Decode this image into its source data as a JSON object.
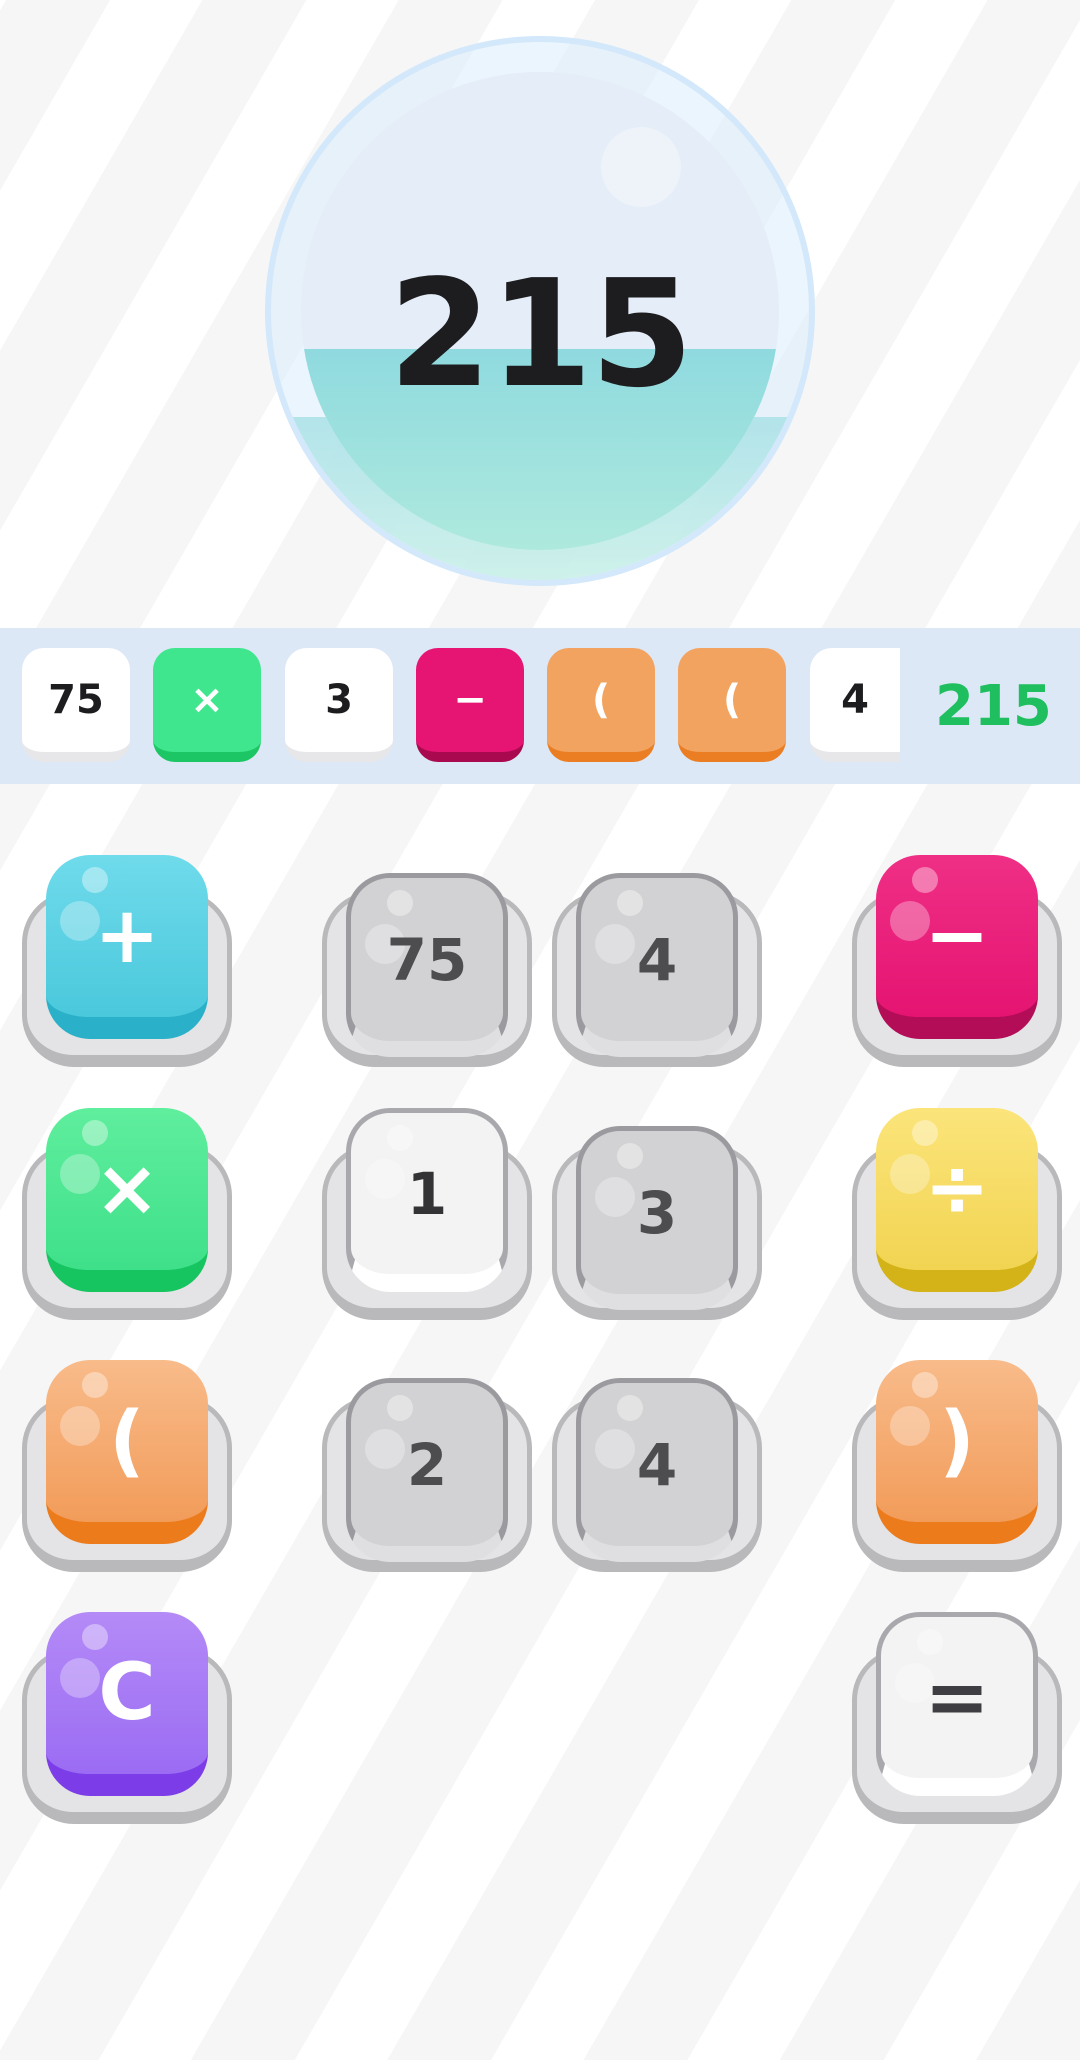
{
  "target": {
    "value": "215",
    "fill_level_percent": 42
  },
  "expression": {
    "tokens": [
      {
        "text": "75",
        "kind": "number"
      },
      {
        "text": "×",
        "kind": "multiply"
      },
      {
        "text": "3",
        "kind": "number"
      },
      {
        "text": "−",
        "kind": "subtract"
      },
      {
        "text": "(",
        "kind": "paren"
      },
      {
        "text": "(",
        "kind": "paren"
      },
      {
        "text": "4",
        "kind": "number"
      }
    ],
    "result": "215",
    "result_color": "#1fbf5f"
  },
  "keypad": {
    "plus": "+",
    "minus": "−",
    "multiply": "×",
    "divide": "÷",
    "open_paren": "(",
    "close_paren": ")",
    "clear": "C",
    "equals": "=",
    "numbers": [
      {
        "value": "75",
        "state": "used"
      },
      {
        "value": "4",
        "state": "used"
      },
      {
        "value": "1",
        "state": "available"
      },
      {
        "value": "3",
        "state": "used"
      },
      {
        "value": "2",
        "state": "used"
      },
      {
        "value": "4",
        "state": "used"
      }
    ]
  },
  "colors": {
    "plus": "#4ac8dc",
    "minus": "#e51472",
    "multiply": "#3fe08a",
    "divide": "#f2d452",
    "paren": "#f29c5a",
    "clear": "#9b6cf3"
  }
}
